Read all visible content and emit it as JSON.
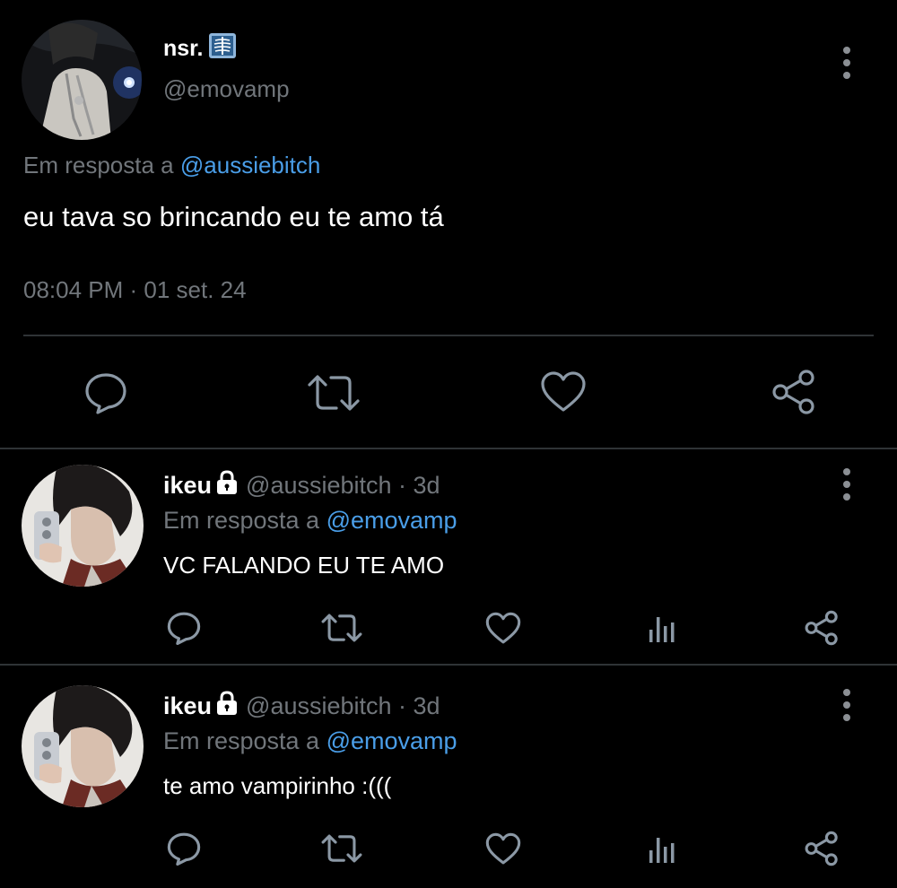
{
  "main_tweet": {
    "display_name": "nsr.",
    "name_emoji": "x-ray-emoji",
    "handle": "@emovamp",
    "reply_to_prefix": "Em resposta a",
    "reply_to_handle": "@aussiebitch",
    "text": "eu tava so brincando eu te amo tá",
    "timestamp": "08:04 PM · 01 set. 24",
    "actions": [
      "reply-icon",
      "retweet-icon",
      "like-icon",
      "share-icon"
    ]
  },
  "replies": [
    {
      "display_name": "ikeu",
      "protected_icon": "lock-icon",
      "handle_meta": "@aussiebitch · 3d",
      "reply_to_prefix": "Em resposta a",
      "reply_to_handle": "@emovamp",
      "text": "VC FALANDO EU TE AMO",
      "actions": [
        "reply-icon",
        "retweet-icon",
        "like-icon",
        "views-icon",
        "share-icon"
      ]
    },
    {
      "display_name": "ikeu",
      "protected_icon": "lock-icon",
      "handle_meta": "@aussiebitch · 3d",
      "reply_to_prefix": "Em resposta a",
      "reply_to_handle": "@emovamp",
      "text": "te amo vampirinho :(((",
      "actions": [
        "reply-icon",
        "retweet-icon",
        "like-icon",
        "views-icon",
        "share-icon"
      ]
    }
  ],
  "colors": {
    "background": "#000000",
    "primary_text": "#e7e9ea",
    "secondary_text": "#71767b",
    "link": "#4a9ee8",
    "divider": "#2f3336"
  }
}
